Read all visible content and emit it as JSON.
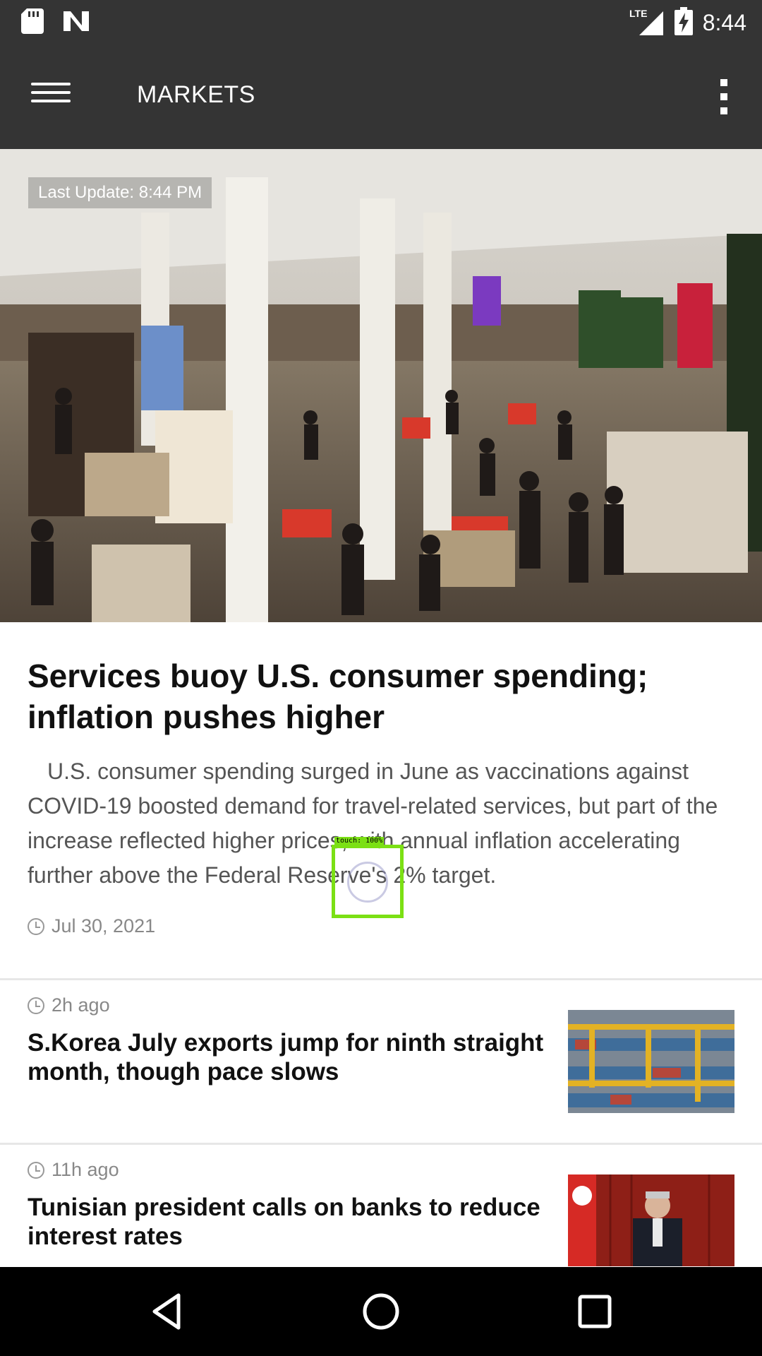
{
  "status_bar": {
    "time": "8:44",
    "network": "LTE",
    "icons": [
      "sd-card-icon",
      "n-app-icon",
      "lte-signal-icon",
      "battery-charging-icon"
    ]
  },
  "app_bar": {
    "title": "MARKETS",
    "menu_icon": "hamburger-menu-icon",
    "overflow_icon": "more-vertical-icon"
  },
  "hero": {
    "last_update": "Last Update: 8:44 PM"
  },
  "lead_story": {
    "title": "Services buoy U.S. consumer spending; inflation pushes higher",
    "summary": "U.S. consumer spending surged in June as vaccinations against COVID-19 boosted demand for travel-related services, but part of the increase reflected higher prices, with annual inflation accelerating further above the Federal Reserve's 2% target.",
    "date": "Jul 30, 2021"
  },
  "stories": [
    {
      "time_ago": "2h ago",
      "title": "S.Korea July exports jump for ninth straight month, though pace slows"
    },
    {
      "time_ago": "11h ago",
      "title": "Tunisian president calls on banks to reduce interest rates"
    }
  ],
  "touch_indicator": {
    "label": "touch: 100%"
  },
  "nav_bar": {
    "buttons": [
      "back-icon",
      "home-icon",
      "recents-icon"
    ]
  },
  "colors": {
    "app_bar": "#343434",
    "nav_bar": "#000000",
    "touch_box": "#7be014"
  }
}
